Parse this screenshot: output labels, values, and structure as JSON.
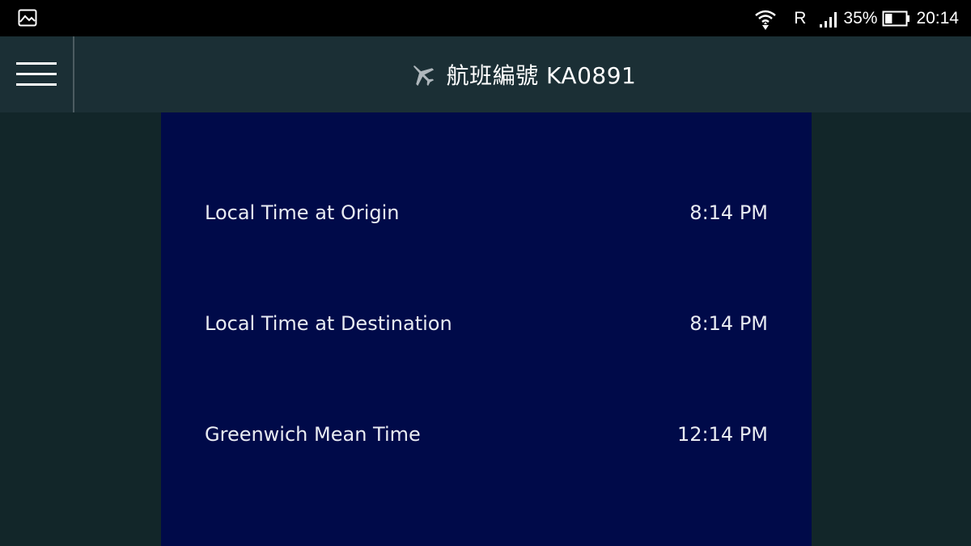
{
  "status_bar": {
    "left_icon": "image-icon",
    "wifi_icon": "wifi-icon",
    "roaming": "R",
    "signal_icon": "signal-icon",
    "battery_percent": "35%",
    "battery_icon": "battery-icon",
    "battery_level": 0.35,
    "time": "20:14"
  },
  "header": {
    "menu_icon": "hamburger-menu-icon",
    "plane_icon": "airplane-icon",
    "title": "航班編號 KA0891"
  },
  "times": [
    {
      "label": "Local Time at Origin",
      "value": "8:14 PM"
    },
    {
      "label": "Local Time at Destination",
      "value": "8:14 PM"
    },
    {
      "label": "Greenwich Mean Time",
      "value": "12:14 PM"
    }
  ],
  "colors": {
    "status_bar": "#000000",
    "header": "#1b2f35",
    "background": "#122629",
    "panel": "#000a49",
    "text": "#ffffff"
  }
}
